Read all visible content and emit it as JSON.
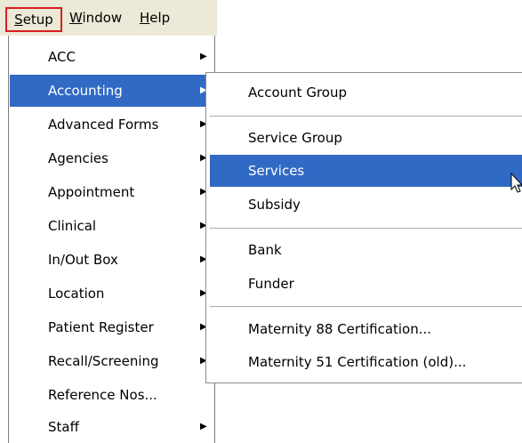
{
  "menubar": {
    "setup": {
      "underline": "S",
      "rest": "etup"
    },
    "window": {
      "underline": "W",
      "rest": "indow"
    },
    "help": {
      "underline": "H",
      "rest": "elp"
    }
  },
  "setup_menu": {
    "items": [
      {
        "label": "ACC",
        "has_submenu": true
      },
      {
        "label": "Accounting",
        "has_submenu": true,
        "selected": true
      },
      {
        "label": "Advanced Forms",
        "has_submenu": true
      },
      {
        "label": "Agencies",
        "has_submenu": true
      },
      {
        "label": "Appointment",
        "has_submenu": true
      },
      {
        "label": "Clinical",
        "has_submenu": true
      },
      {
        "label": "In/Out Box",
        "has_submenu": true
      },
      {
        "label": "Location",
        "has_submenu": true
      },
      {
        "label": "Patient Register",
        "has_submenu": true
      },
      {
        "label": "Recall/Screening",
        "has_submenu": true
      },
      {
        "label": "Reference Nos...",
        "has_submenu": false
      },
      {
        "label": "Staff",
        "has_submenu": true
      }
    ]
  },
  "accounting_submenu": {
    "items": [
      {
        "label": "Account Group"
      },
      {
        "label": "Service Group"
      },
      {
        "label": "Services",
        "selected": true
      },
      {
        "label": "Subsidy"
      },
      {
        "label": "Bank"
      },
      {
        "label": "Funder"
      },
      {
        "label": "Maternity 88 Certification..."
      },
      {
        "label": "Maternity 51 Certification (old)..."
      }
    ]
  },
  "colors": {
    "selection": "#316ac5",
    "menubar": "#ece9d8",
    "highlight_box": "#d81e1e"
  },
  "icons": {
    "submenu_arrow": "arrow-right-icon",
    "pointer": "mouse-pointer-icon"
  }
}
